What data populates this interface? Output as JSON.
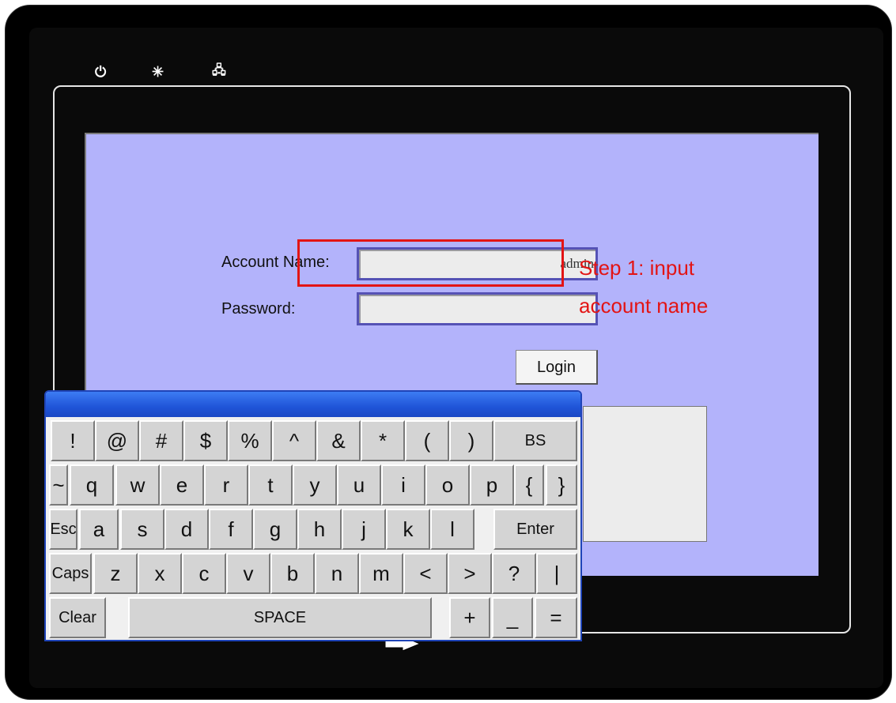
{
  "device": {
    "status_icons": [
      "power-icon",
      "brightness-icon",
      "network-icon"
    ],
    "power_glyph": "⏻",
    "brightness_glyph": "✳",
    "network_glyph": "🖧"
  },
  "login": {
    "account_label": "Account Name:",
    "account_value": "admin",
    "password_label": "Password:",
    "password_value": "",
    "login_button": "Login"
  },
  "annotation": {
    "line1": "Step 1: input",
    "line2": "account name",
    "color": "#e31414"
  },
  "keyboard": {
    "rows": [
      [
        "!",
        "@",
        "#",
        "$",
        "%",
        "^",
        "&",
        "*",
        "(",
        ")",
        "BS"
      ],
      [
        "~",
        "q",
        "w",
        "e",
        "r",
        "t",
        "y",
        "u",
        "i",
        "o",
        "p",
        "{",
        "}"
      ],
      [
        "Esc",
        "a",
        "s",
        "d",
        "f",
        "g",
        "h",
        "j",
        "k",
        "l",
        "Enter"
      ],
      [
        "Caps",
        "z",
        "x",
        "c",
        "v",
        "b",
        "n",
        "m",
        "<",
        ">",
        "?",
        "|"
      ],
      [
        "Clear",
        "SPACE",
        "+",
        "_",
        "="
      ]
    ]
  },
  "colors": {
    "screen_bg": "#b3b3fb",
    "keyboard_title": "#1f54d8",
    "field_border": "#5552b5"
  }
}
